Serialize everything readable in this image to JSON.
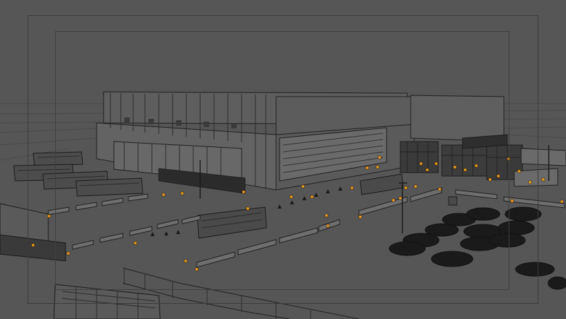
{
  "viewport": {
    "background_color": "#565656",
    "wire_color": "#1f1f1f",
    "light_color": "#f0a020",
    "frame_color": "#3b3b3b"
  },
  "scene": {
    "objects": [
      "stadium-building",
      "bus",
      "fence",
      "barrier",
      "traffic-cone",
      "car",
      "stage-truss",
      "tent",
      "guard-booth",
      "lamp-post",
      "forklift"
    ]
  }
}
